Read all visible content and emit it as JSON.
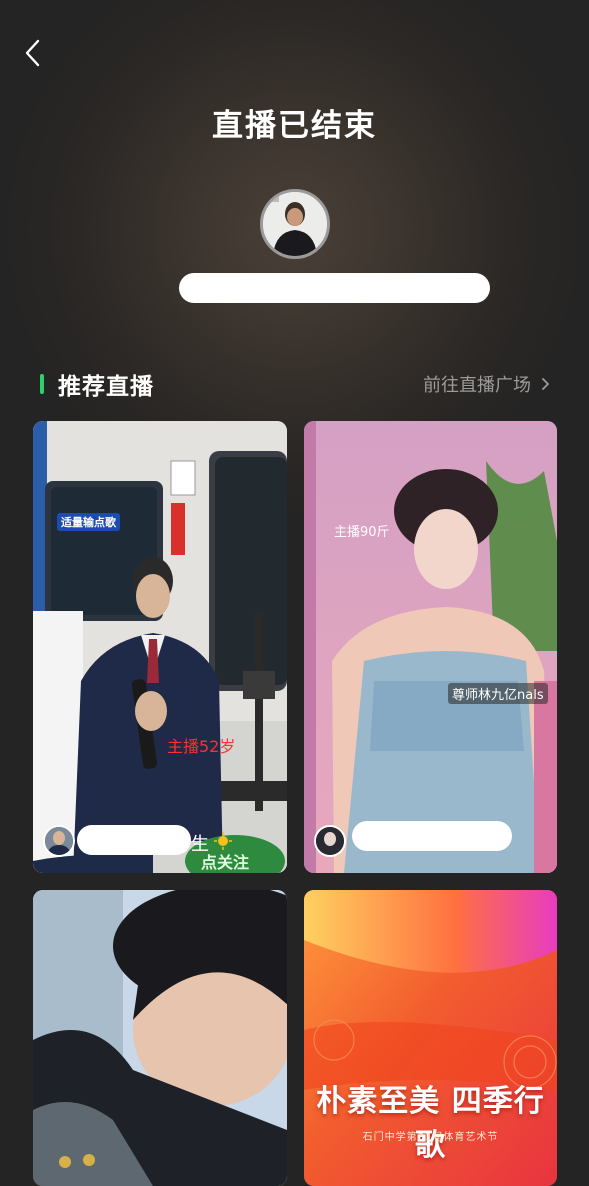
{
  "header": {
    "title": "直播已结束",
    "back_icon": "chevron-left-icon"
  },
  "host": {
    "avatar_icon": "host-avatar",
    "name": ""
  },
  "recommend": {
    "title": "推荐直播",
    "link_label": "前往直播广场",
    "link_icon": "chevron-right-icon",
    "accent_color": "#2fd06a"
  },
  "cards": [
    {
      "overlay_top": "适量输点歌",
      "overlay_red": "主播52岁",
      "name_suffix": "生",
      "button_text": "点关注",
      "name": ""
    },
    {
      "overlay_weight": "主播90斤",
      "overlay_caption": "尊师林九亿nals",
      "name": ""
    },
    {
      "name": ""
    },
    {
      "poster_title": "朴素至美 四季行歌",
      "poster_sub": "石门中学第31届体育艺术节"
    }
  ]
}
